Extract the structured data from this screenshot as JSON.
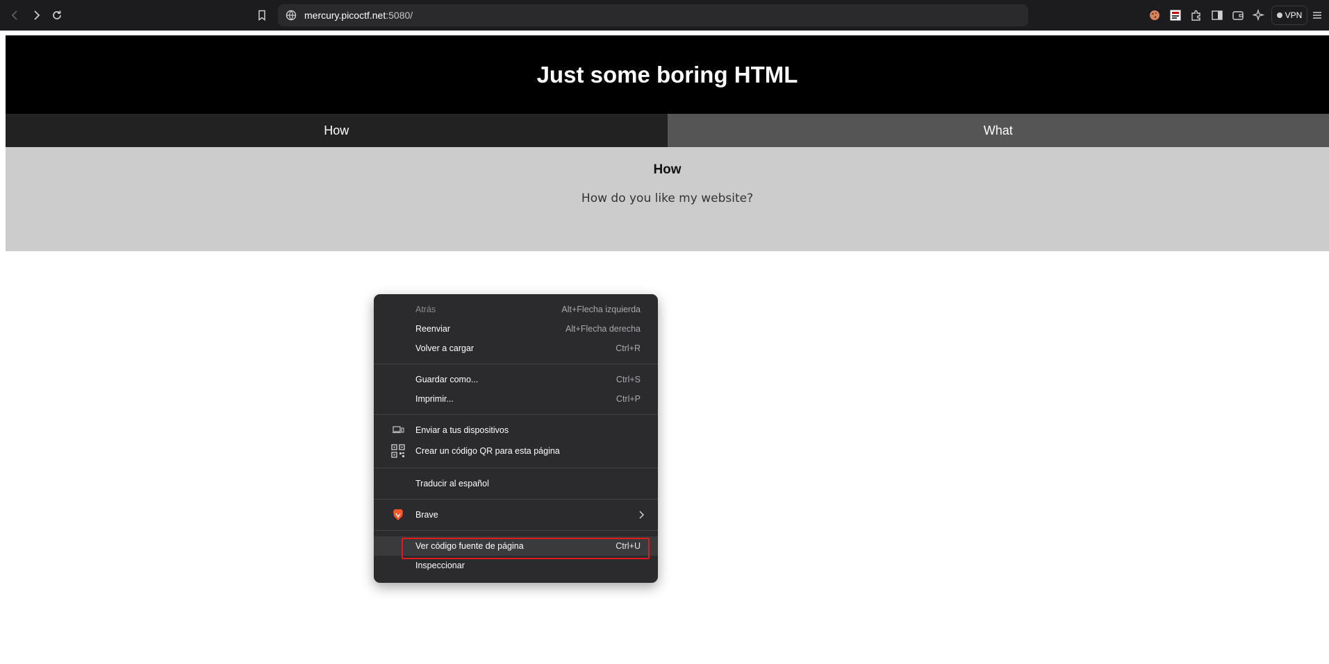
{
  "browser": {
    "url_host": "mercury.picoctf.net",
    "url_port_path": ":5080/",
    "vpn_label": "VPN"
  },
  "page": {
    "title": "Just some boring HTML",
    "tabs": [
      {
        "label": "How",
        "active": true
      },
      {
        "label": "What",
        "active": false
      }
    ],
    "content": {
      "heading": "How",
      "text": "How do you like my website?"
    }
  },
  "context_menu": {
    "items": [
      {
        "label": "Atrás",
        "shortcut": "Alt+Flecha izquierda",
        "disabled": true
      },
      {
        "label": "Reenviar",
        "shortcut": "Alt+Flecha derecha"
      },
      {
        "label": "Volver a cargar",
        "shortcut": "Ctrl+R"
      },
      {
        "label": "Guardar como...",
        "shortcut": "Ctrl+S"
      },
      {
        "label": "Imprimir...",
        "shortcut": "Ctrl+P"
      },
      {
        "label": "Enviar a tus dispositivos",
        "icon": "devices-icon"
      },
      {
        "label": "Crear un código QR para esta página",
        "icon": "qr-code-icon"
      },
      {
        "label": "Traducir al español"
      },
      {
        "label": "Brave",
        "icon": "brave-lion-icon"
      },
      {
        "label": "Ver código fuente de página",
        "shortcut": "Ctrl+U",
        "highlighted": true
      },
      {
        "label": "Inspeccionar"
      }
    ]
  },
  "colors": {
    "highlight_border": "#e0191d",
    "menu_bg": "#2b2b2e",
    "brave_orange": "#fb542b"
  }
}
